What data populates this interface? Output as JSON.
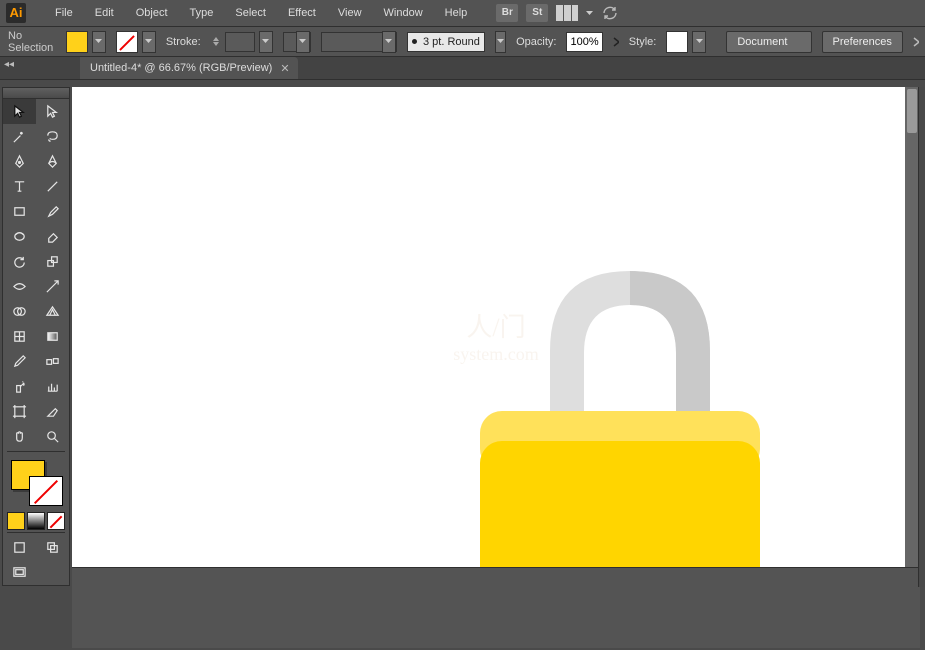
{
  "app": {
    "logo": "Ai"
  },
  "menu": [
    "File",
    "Edit",
    "Object",
    "Type",
    "Select",
    "Effect",
    "View",
    "Window",
    "Help"
  ],
  "ext_buttons": {
    "bridge": "Br",
    "stock": "St"
  },
  "options": {
    "selection": "No Selection",
    "stroke_label": "Stroke:",
    "brush_text": "3 pt. Round",
    "opacity_label": "Opacity:",
    "opacity_value": "100%",
    "style_label": "Style:",
    "doc_setup": "Document Setup",
    "prefs": "Preferences"
  },
  "tab": {
    "title": "Untitled-4* @ 66.67% (RGB/Preview)"
  },
  "watermark": {
    "line1": "人/门",
    "line2": "system.com"
  },
  "colors": {
    "fill": "#ffd11a",
    "fill_light": "#ffe15a",
    "shackle": "#dedede",
    "shackle_shadow": "#c9c9c9"
  },
  "tools_left": [
    "selection",
    "pen",
    "curvature",
    "type",
    "rectangle",
    "ellipse",
    "pencil",
    "rotate",
    "width",
    "free-transform",
    "shape-builder",
    "mesh",
    "eyedropper",
    "blend",
    "artboard",
    "hand"
  ],
  "tools_right": [
    "direct-selection",
    "magic-wand",
    "anchor-point",
    "line",
    "paintbrush",
    "eraser",
    "scissors",
    "scale",
    "warp",
    "puppet",
    "perspective",
    "gradient",
    "measure",
    "column-graph",
    "slice",
    "zoom"
  ]
}
